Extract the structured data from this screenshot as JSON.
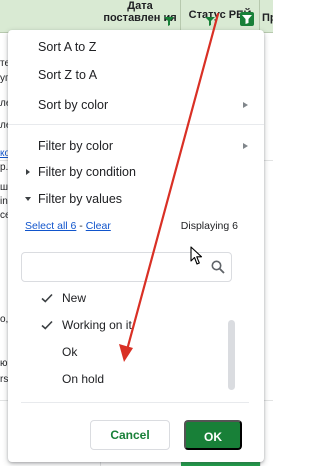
{
  "sheet": {
    "headers": [
      {
        "text": "Дата поставлен ия"
      },
      {
        "text": "Статус РЕЙ"
      },
      {
        "text": "Пр"
      }
    ],
    "left_fragments": [
      {
        "text": "те",
        "link": false
      },
      {
        "text": "уп",
        "link": false
      },
      {
        "text": "ле",
        "link": false
      },
      {
        "text": "ле",
        "link": false
      },
      {
        "text": "ко",
        "link": true
      },
      {
        "text": "р.",
        "link": false
      },
      {
        "text": "ш",
        "link": false
      },
      {
        "text": "in",
        "link": false
      },
      {
        "text": "се",
        "link": false
      },
      {
        "text": "o,",
        "link": false
      },
      {
        "text": "ю",
        "link": false
      },
      {
        "text": "rs",
        "link": false
      }
    ],
    "accent_green": "#188038",
    "header_bg": "#d9ead3"
  },
  "menu": {
    "items": [
      {
        "label": "Sort A to Z",
        "submenu": false
      },
      {
        "label": "Sort Z to A",
        "submenu": false
      },
      {
        "label": "Sort by color",
        "submenu": true
      },
      {
        "label": "Filter by color",
        "submenu": true
      },
      {
        "label": "Filter by condition",
        "expanded": false
      },
      {
        "label": "Filter by values",
        "expanded": true
      }
    ],
    "select_all_label": "Select all 6",
    "separator": " - ",
    "clear_label": "Clear",
    "displaying_label": "Displaying 6",
    "search": {
      "value": "",
      "placeholder": ""
    },
    "values": [
      {
        "label": "New",
        "checked": true
      },
      {
        "label": "Working on it",
        "checked": true
      },
      {
        "label": "Ok",
        "checked": false
      },
      {
        "label": "On hold",
        "checked": false
      }
    ],
    "cancel_label": "Cancel",
    "ok_label": "OK"
  },
  "annotation": {
    "arrow_color": "#d93025"
  }
}
